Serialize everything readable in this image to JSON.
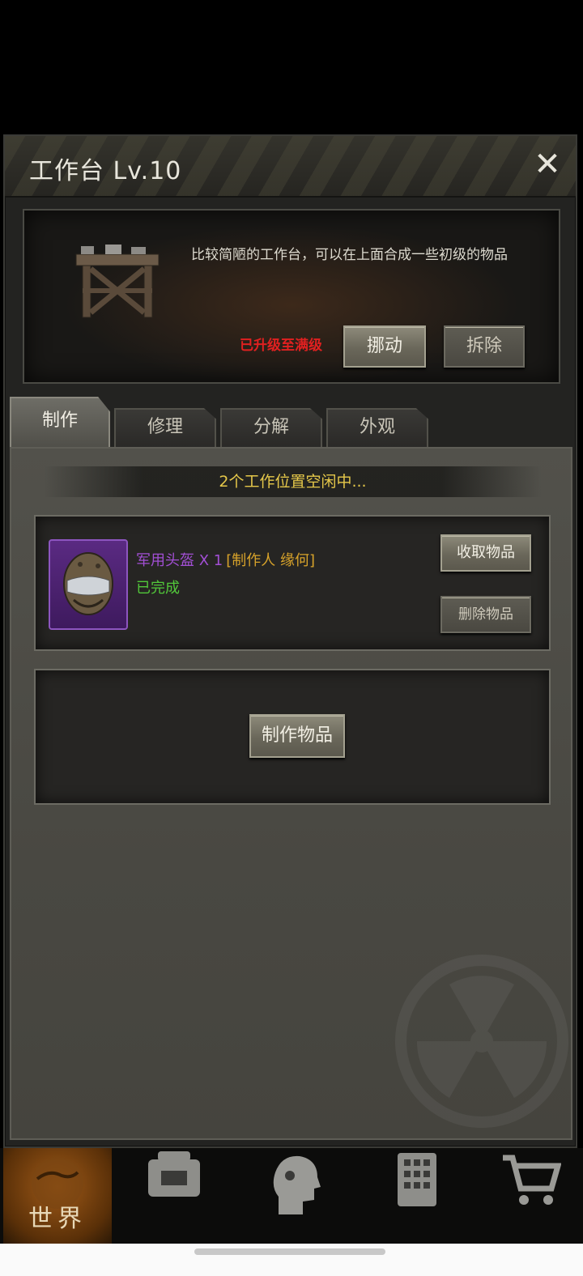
{
  "top_stats": [
    "",
    ""
  ],
  "panel": {
    "title": "工作台 Lv.10",
    "close_label": "✕"
  },
  "info": {
    "description": "比较简陋的工作台，可以在上面合成一些初级的物品",
    "max_level": "已升级至满级",
    "move_label": "挪动",
    "dismantle_label": "拆除"
  },
  "tabs": [
    {
      "label": "制作",
      "active": true
    },
    {
      "label": "修理",
      "active": false
    },
    {
      "label": "分解",
      "active": false
    },
    {
      "label": "外观",
      "active": false
    }
  ],
  "craft": {
    "slots_status": "2个工作位置空闲中...",
    "job": {
      "item_name": "军用头盔 X 1",
      "maker": "[制作人 缘何]",
      "status": "已完成",
      "collect_label": "收取物品",
      "delete_label": "删除物品"
    },
    "craft_label": "制作物品"
  },
  "bottom_nav": {
    "world_label": "世界"
  },
  "colors": {
    "item_purple": "#a24fd4",
    "maker_gold": "#d8a32a",
    "status_green": "#52c83a",
    "warning_red": "#e02020",
    "banner_yellow": "#e6c84a"
  }
}
